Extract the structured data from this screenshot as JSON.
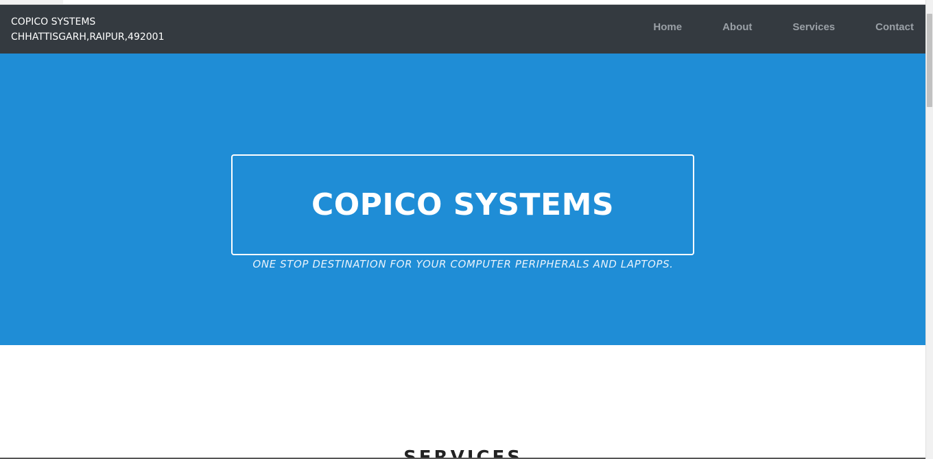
{
  "brand": {
    "name": "COPICO SYSTEMS",
    "address": "CHHATTISGARH,RAIPUR,492001"
  },
  "nav": {
    "items": [
      {
        "label": "Home"
      },
      {
        "label": "About"
      },
      {
        "label": "Services"
      },
      {
        "label": "Contact"
      }
    ]
  },
  "hero": {
    "title": "COPICO SYSTEMS",
    "subtitle": "ONE STOP DESTINATION FOR YOUR COMPUTER PERIPHERALS AND LAPTOPS."
  },
  "services": {
    "heading": "SERVICES"
  },
  "colors": {
    "navbar": "#343a40",
    "hero": "#1f8dd6",
    "nav_link": "#9aa0a6"
  }
}
